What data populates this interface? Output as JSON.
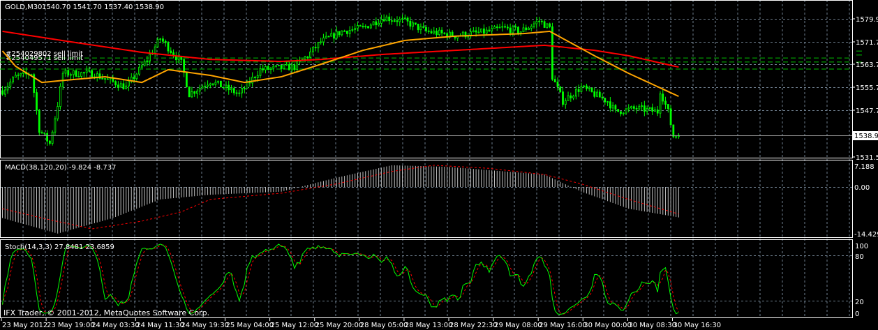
{
  "header": {
    "symbol": "GOLD,M30",
    "ohlc": "1540.70 1541.70 1537.40 1538.90"
  },
  "colors": {
    "bull": "#00ff00",
    "bear": "#00ff00",
    "ma_slow": "#ff0000",
    "ma_fast": "#ffa500",
    "grid": "#708090",
    "order_line": "#00c000"
  },
  "orders": [
    {
      "label": "#254029802 sell limit",
      "price": 1566.1
    },
    {
      "label": "#254049571 sell limit",
      "price": 1564.7
    },
    {
      "label": "",
      "price": 1562.2
    }
  ],
  "price_axis": {
    "labels": [
      "1579.90",
      "1571.70",
      "1563.70",
      "1555.70",
      "1547.70",
      "1531.50"
    ],
    "current": "1538.90"
  },
  "macd": {
    "title": "MACD(38,120,20) -9.824 -8.737",
    "axis": [
      "7.188",
      "0.00",
      "-14.429"
    ],
    "main": [
      [
        0,
        -10
      ],
      [
        21,
        -15
      ],
      [
        42,
        -10
      ],
      [
        60,
        -4
      ],
      [
        79,
        -2.5
      ],
      [
        106,
        -1.5
      ],
      [
        127,
        3
      ],
      [
        148,
        7
      ],
      [
        169,
        6.5
      ],
      [
        206,
        4
      ],
      [
        220,
        -1.5
      ],
      [
        238,
        -7
      ],
      [
        257,
        -9.8
      ]
    ],
    "signal": [
      [
        0,
        -7
      ],
      [
        15,
        -10
      ],
      [
        34,
        -13.5
      ],
      [
        53,
        -11
      ],
      [
        68,
        -8
      ],
      [
        79,
        -4
      ],
      [
        106,
        -2
      ],
      [
        127,
        1
      ],
      [
        148,
        5
      ],
      [
        164,
        7
      ],
      [
        185,
        6
      ],
      [
        206,
        4
      ],
      [
        220,
        1
      ],
      [
        238,
        -4
      ],
      [
        257,
        -8.7
      ]
    ]
  },
  "stoch": {
    "title": "Stoch(14,3,3) 27.8481 23.6859",
    "axis": [
      "100",
      "80",
      "20",
      "0"
    ]
  },
  "copyright": "IFX Trader, © 2001-2012, MetaQuotes Software Corp.",
  "time_axis": [
    "23 May 2012",
    "23 May 19:00",
    "24 May 03:30",
    "24 May 11:30",
    "24 May 19:30",
    "25 May 04:00",
    "25 May 12:00",
    "25 May 20:00",
    "28 May 05:00",
    "28 May 13:00",
    "28 May 22:30",
    "29 May 08:00",
    "29 May 16:00",
    "30 May 00:00",
    "30 May 08:30",
    "30 May 16:30"
  ],
  "chart_data": {
    "type": "candlestick",
    "bars": 258,
    "close_anchors": [
      [
        0,
        1554.6
      ],
      [
        5,
        1559.5
      ],
      [
        11,
        1560.7
      ],
      [
        14,
        1541
      ],
      [
        18,
        1536
      ],
      [
        21,
        1549.7
      ],
      [
        23,
        1560.7
      ],
      [
        34,
        1560.7
      ],
      [
        47,
        1555.8
      ],
      [
        55,
        1565.6
      ],
      [
        60,
        1573
      ],
      [
        68,
        1564.4
      ],
      [
        71,
        1553.4
      ],
      [
        79,
        1558
      ],
      [
        90,
        1553.4
      ],
      [
        98,
        1562
      ],
      [
        111,
        1563
      ],
      [
        116,
        1567
      ],
      [
        121,
        1571.8
      ],
      [
        129,
        1575.5
      ],
      [
        137,
        1576.7
      ],
      [
        145,
        1580.4
      ],
      [
        153,
        1579
      ],
      [
        161,
        1575.5
      ],
      [
        172,
        1574
      ],
      [
        185,
        1575.5
      ],
      [
        190,
        1576.7
      ],
      [
        197,
        1575.5
      ],
      [
        204,
        1579.2
      ],
      [
        208,
        1576.7
      ],
      [
        209,
        1559.5
      ],
      [
        213,
        1550.9
      ],
      [
        220,
        1555.8
      ],
      [
        230,
        1550.9
      ],
      [
        233,
        1547.2
      ],
      [
        241,
        1548.4
      ],
      [
        249,
        1547.2
      ],
      [
        250,
        1554.6
      ],
      [
        253,
        1547.2
      ],
      [
        255,
        1538.6
      ],
      [
        257,
        1538.9
      ]
    ],
    "ma_slow_anchors": [
      [
        0,
        1575.5
      ],
      [
        26,
        1571.8
      ],
      [
        53,
        1568.1
      ],
      [
        79,
        1565.6
      ],
      [
        106,
        1564.9
      ],
      [
        121,
        1565.6
      ],
      [
        145,
        1567.4
      ],
      [
        172,
        1568.8
      ],
      [
        206,
        1570.6
      ],
      [
        225,
        1568.8
      ],
      [
        238,
        1566.9
      ],
      [
        257,
        1562.9
      ]
    ],
    "ma_fast_anchors": [
      [
        0,
        1568.6
      ],
      [
        5,
        1563.2
      ],
      [
        15,
        1557.5
      ],
      [
        23,
        1558.2
      ],
      [
        39,
        1559.5
      ],
      [
        53,
        1557.5
      ],
      [
        63,
        1562
      ],
      [
        79,
        1560
      ],
      [
        92,
        1557.5
      ],
      [
        106,
        1559.5
      ],
      [
        121,
        1563.9
      ],
      [
        137,
        1568.8
      ],
      [
        153,
        1572.3
      ],
      [
        172,
        1573.8
      ],
      [
        198,
        1574.7
      ],
      [
        208,
        1575.5
      ],
      [
        225,
        1566.9
      ],
      [
        238,
        1560.7
      ],
      [
        257,
        1552.6
      ]
    ],
    "ylim": [
      1531.5,
      1582
    ]
  }
}
